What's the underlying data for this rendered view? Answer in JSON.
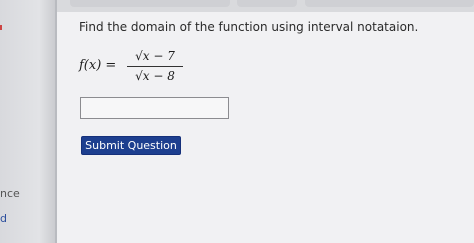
{
  "sidebar": {
    "partial_text_1": "nce",
    "partial_text_2": "d"
  },
  "question": {
    "prompt": "Find the domain of the function using interval notataion.",
    "function_lhs": "f(x) =",
    "numerator": "√x − 7",
    "denominator": "√x − 8"
  },
  "answer": {
    "value": "",
    "placeholder": ""
  },
  "actions": {
    "submit_label": "Submit Question"
  },
  "colors": {
    "submit_button": "#1d3f8f",
    "page_background": "#f1f1f3"
  }
}
